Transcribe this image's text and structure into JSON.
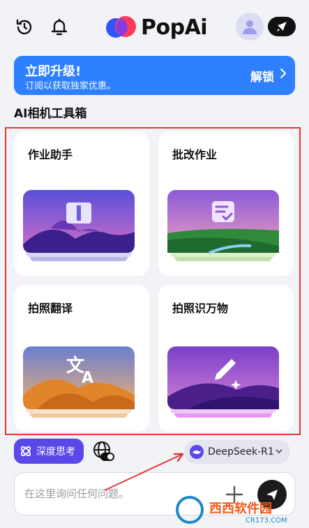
{
  "header": {
    "app_name": "PopAi",
    "icons": [
      "history-icon",
      "bell-icon",
      "avatar-icon",
      "rocket-icon"
    ]
  },
  "banner": {
    "title": "立即升级!",
    "subtitle": "订阅以获取独家优惠。",
    "action": "解锁"
  },
  "section_title": "AI相机工具箱",
  "tools": [
    {
      "label": "作业助手",
      "icon": "book-icon"
    },
    {
      "label": "批改作业",
      "icon": "checklist-icon"
    },
    {
      "label": "拍照翻译",
      "icon": "translate-icon"
    },
    {
      "label": "拍照识万物",
      "icon": "pencil-sparkle-icon"
    }
  ],
  "composer": {
    "deep_think_label": "深度思考",
    "model_label": "DeepSeek-R1",
    "input_placeholder": "在这里询问任何问题。"
  },
  "watermark": {
    "text": "西西软件园",
    "sub": "CR173.COM"
  },
  "colors": {
    "accent": "#2f80ff",
    "deep_think": "#5b48e8",
    "annotation_red": "#e23838"
  }
}
